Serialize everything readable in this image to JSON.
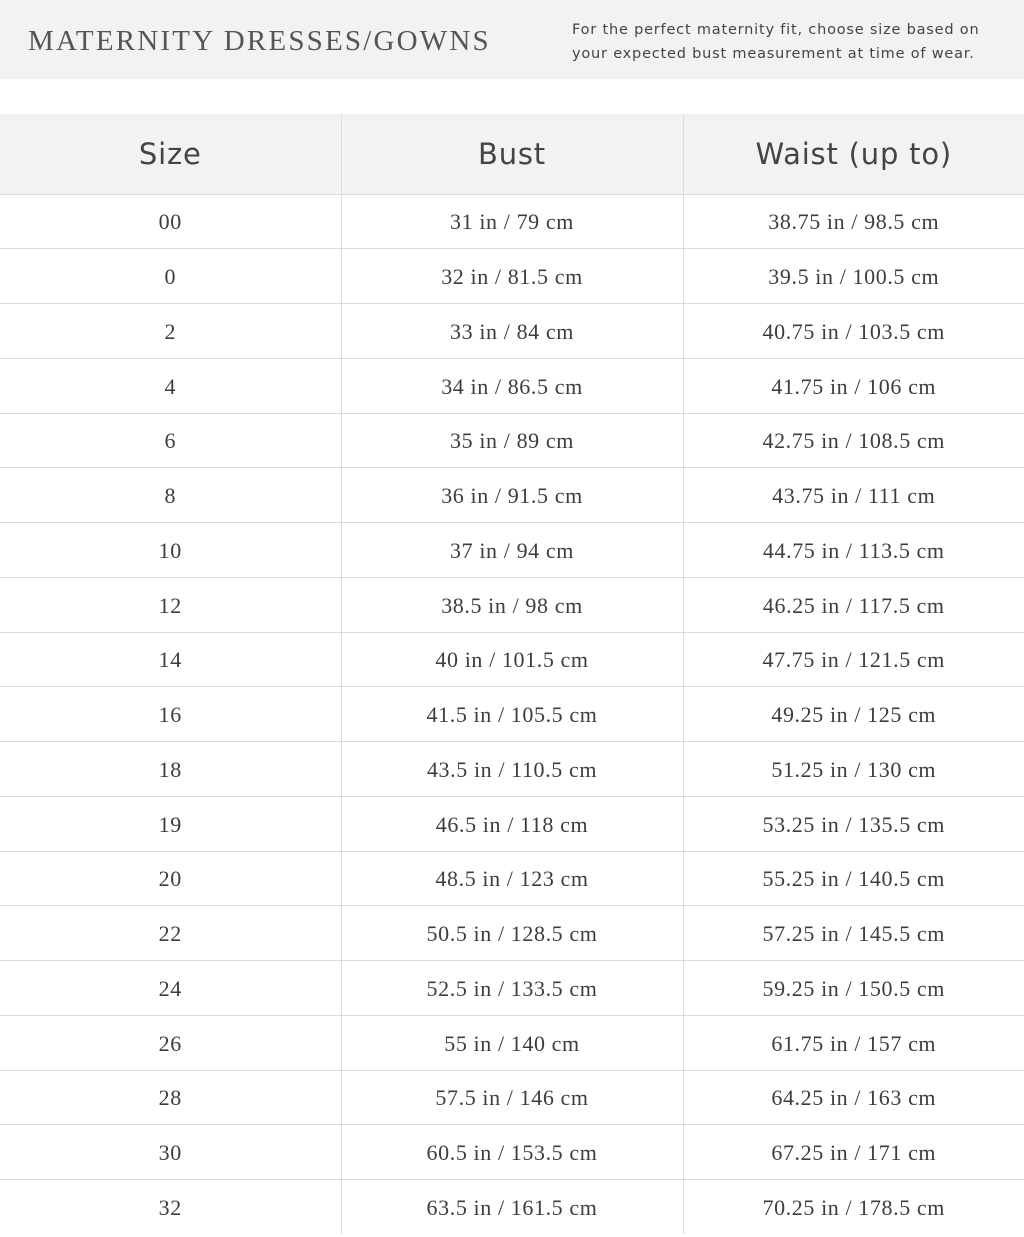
{
  "header": {
    "title": "MATERNITY DRESSES/GOWNS",
    "note": "For the perfect maternity fit, choose size based on your expected bust measurement at time of wear."
  },
  "table": {
    "columns": [
      "Size",
      "Bust",
      "Waist (up to)"
    ],
    "rows": [
      {
        "size": "00",
        "bust": "31 in / 79 cm",
        "waist": "38.75 in / 98.5 cm"
      },
      {
        "size": "0",
        "bust": "32 in / 81.5 cm",
        "waist": "39.5 in / 100.5 cm"
      },
      {
        "size": "2",
        "bust": "33 in / 84 cm",
        "waist": "40.75 in / 103.5 cm"
      },
      {
        "size": "4",
        "bust": "34 in / 86.5 cm",
        "waist": "41.75 in / 106 cm"
      },
      {
        "size": "6",
        "bust": "35 in / 89 cm",
        "waist": "42.75 in / 108.5 cm"
      },
      {
        "size": "8",
        "bust": "36 in / 91.5 cm",
        "waist": "43.75 in / 111 cm"
      },
      {
        "size": "10",
        "bust": "37 in / 94 cm",
        "waist": "44.75 in / 113.5 cm"
      },
      {
        "size": "12",
        "bust": "38.5 in / 98 cm",
        "waist": "46.25 in / 117.5 cm"
      },
      {
        "size": "14",
        "bust": "40 in / 101.5 cm",
        "waist": "47.75 in / 121.5 cm"
      },
      {
        "size": "16",
        "bust": "41.5 in / 105.5 cm",
        "waist": "49.25 in / 125 cm"
      },
      {
        "size": "18",
        "bust": "43.5 in / 110.5 cm",
        "waist": "51.25 in / 130 cm"
      },
      {
        "size": "19",
        "bust": "46.5 in / 118 cm",
        "waist": "53.25 in / 135.5 cm"
      },
      {
        "size": "20",
        "bust": "48.5 in / 123 cm",
        "waist": "55.25 in / 140.5 cm"
      },
      {
        "size": "22",
        "bust": "50.5 in / 128.5 cm",
        "waist": "57.25 in / 145.5 cm"
      },
      {
        "size": "24",
        "bust": "52.5 in / 133.5 cm",
        "waist": "59.25 in / 150.5 cm"
      },
      {
        "size": "26",
        "bust": "55 in / 140 cm",
        "waist": "61.75 in / 157 cm"
      },
      {
        "size": "28",
        "bust": "57.5 in / 146 cm",
        "waist": "64.25 in / 163 cm"
      },
      {
        "size": "30",
        "bust": "60.5 in / 153.5 cm",
        "waist": "67.25 in / 171 cm"
      },
      {
        "size": "32",
        "bust": "63.5 in / 161.5 cm",
        "waist": "70.25 in / 178.5 cm"
      }
    ]
  },
  "colors": {
    "header_bg": "#f2f2f2",
    "text": "#3d3d3d",
    "border": "#dcdcdc"
  }
}
